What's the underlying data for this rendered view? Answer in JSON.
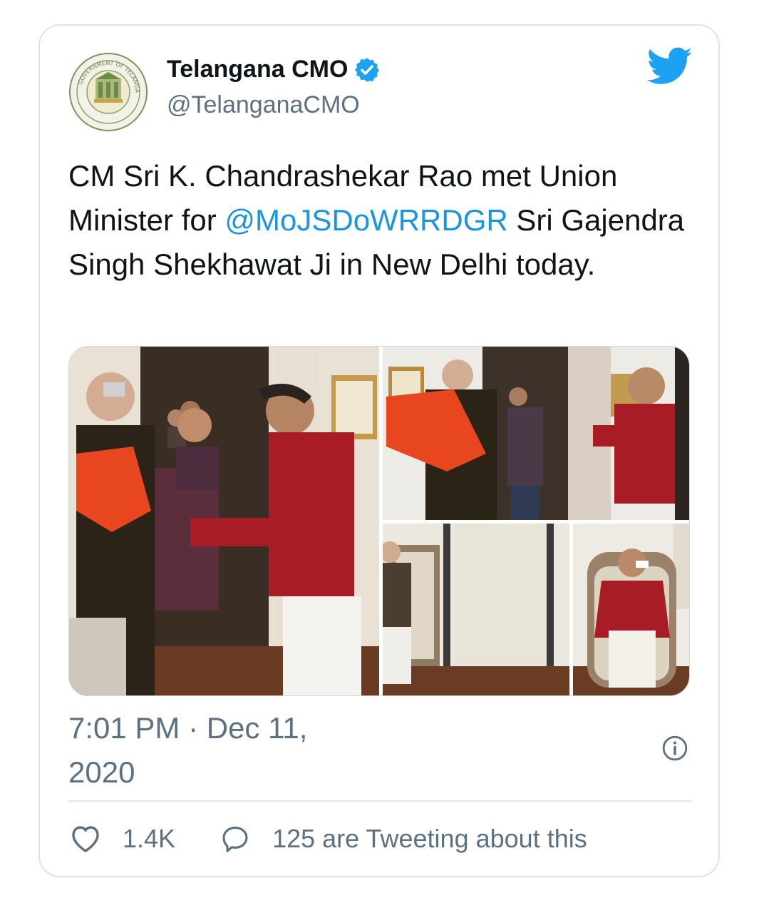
{
  "account": {
    "display_name": "Telangana CMO",
    "handle": "@TelanganaCMO",
    "verified": true,
    "avatar_icon": "telangana-government-emblem",
    "avatar_seal_text": "GOVERNMENT OF TELANGANA"
  },
  "tweet": {
    "text_before_mention": "CM Sri K. Chandrashekar Rao met Union Minister for ",
    "mention": "@MoJSDoWRRDGR",
    "text_after_mention": " Sri Gajendra Singh Shekhawat Ji in New Delhi today.",
    "timestamp": "7:01 PM · Dec 11, 2020"
  },
  "engagement": {
    "likes": "1.4K",
    "conversation": "125 are Tweeting about this"
  },
  "photos": [
    {
      "icon": "photo-shawl-greeting"
    },
    {
      "icon": "photo-namaste-greeting"
    },
    {
      "icon": "photo-minister-seated"
    },
    {
      "icon": "photo-cm-seated"
    }
  ],
  "colors": {
    "accent": "#1b95e0",
    "verified": "#1da1f2",
    "text_primary": "#0f1419",
    "text_secondary": "#5b7083",
    "shawl_red": "#a81c26",
    "scarf_orange": "#e8461e"
  }
}
